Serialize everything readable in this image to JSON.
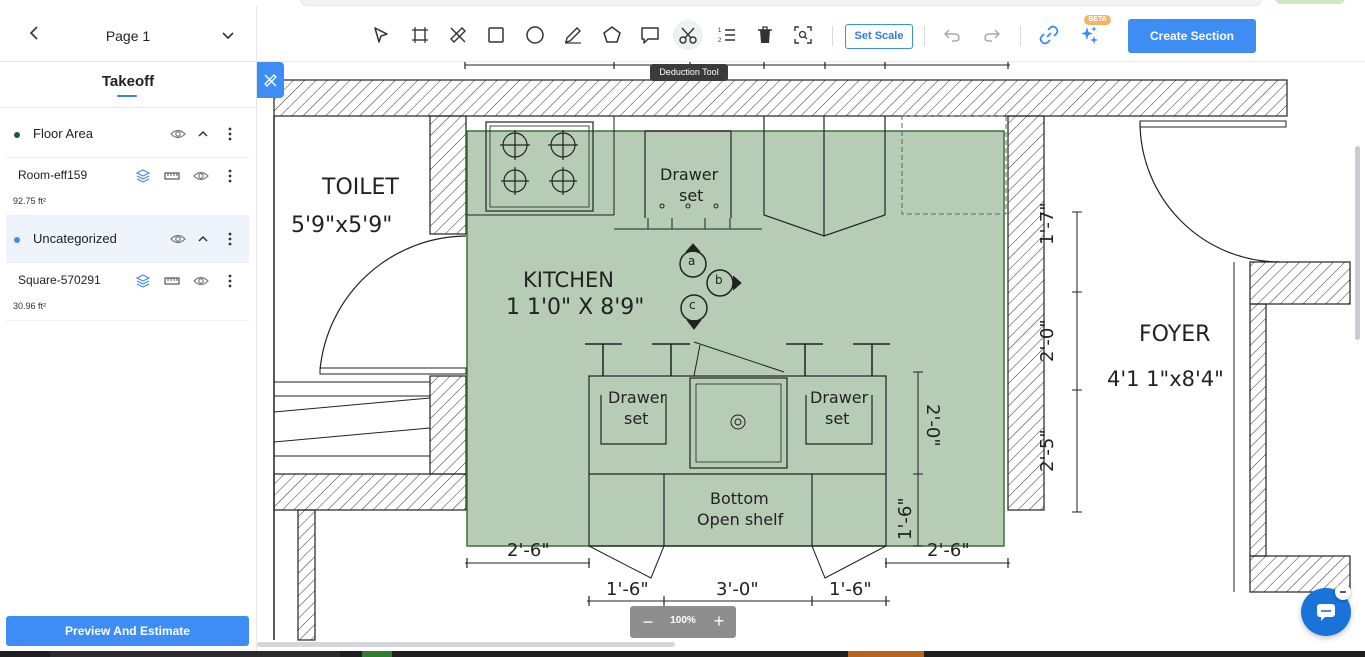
{
  "sidebar": {
    "page_title": "Page 1",
    "takeoff_title": "Takeoff",
    "groups": [
      {
        "name": "Floor Area",
        "color": "#1f7a3a",
        "selected": false
      },
      {
        "name": "Uncategorized",
        "color": "#3d8df5",
        "selected": true
      }
    ],
    "items": [
      {
        "name": "Room-eff159",
        "area": "92.75 ft²"
      },
      {
        "name": "Square-570291",
        "area": "30.96 ft²"
      }
    ],
    "preview_button": "Preview And Estimate"
  },
  "toolbar": {
    "tools": [
      "select-tool",
      "area-select-tool",
      "measure-tool",
      "rectangle-tool",
      "circle-tool",
      "pen-tool",
      "polygon-tool",
      "comment-tool",
      "deduction-tool",
      "count-tool",
      "delete-tool",
      "zoom-fit-tool"
    ],
    "active_tool": "deduction-tool",
    "tooltip": "Deduction Tool",
    "set_scale_label": "Set Scale",
    "beta_badge": "BETA",
    "create_section_label": "Create Section"
  },
  "zoom": {
    "minus": "−",
    "value": "100%",
    "plus": "+"
  },
  "plan": {
    "labels": {
      "toilet": "TOILET",
      "toilet_dim": "5'9\"x5'9\"",
      "kitchen": "KITCHEN",
      "kitchen_dim": "1 1'0\" X 8'9\"",
      "drawer_top": "Drawer",
      "drawer_top2": "set",
      "drawer_left": "Drawer",
      "drawer_left2": "set",
      "drawer_right": "Drawer",
      "drawer_right2": "set",
      "bottom_shelf": "Bottom",
      "bottom_shelf2": "Open shelf",
      "foyer": "FOYER",
      "foyer_dim": "4'1 1\"x8'4\"",
      "dim_1_7": "1'-7\"",
      "dim_2_0a": "2'-0\"",
      "dim_2_5": "2'-5\"",
      "dim_2_0b": "2'-0\"",
      "dim_1_6v": "1'-6\"",
      "dim_2_6l": "2'-6\"",
      "dim_2_6r": "2'-6\"",
      "dim_1_6a": "1'-6\"",
      "dim_3_0": "3'-0\"",
      "dim_1_6b": "1'-6\"",
      "circle_a": "a",
      "circle_b": "b",
      "circle_c": "c"
    },
    "kitchen_fill": "#b7ccb5",
    "kitchen_stroke": "#3f6e3a"
  },
  "colors": {
    "accent": "#3d8df5",
    "beta": "#f7b267"
  }
}
